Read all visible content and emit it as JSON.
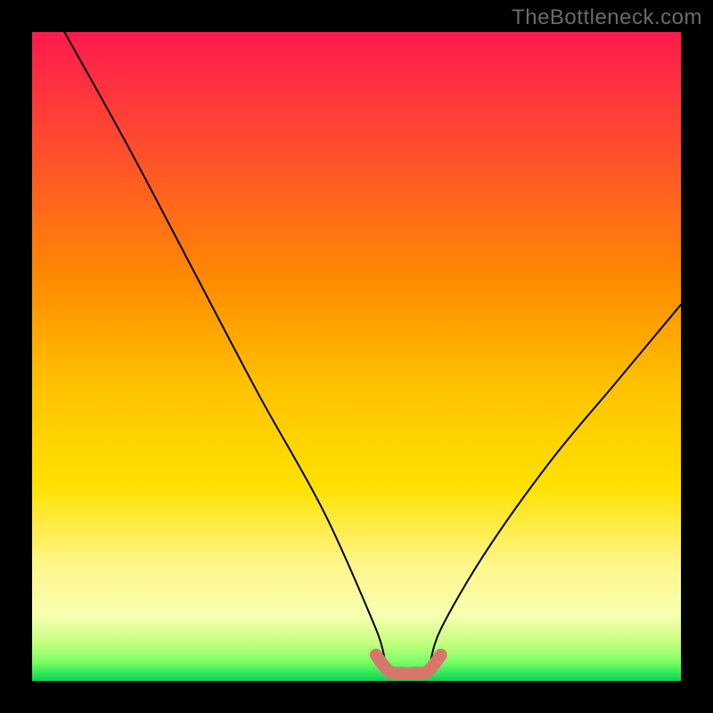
{
  "watermark": "TheBottleneck.com",
  "chart_data": {
    "type": "line",
    "title": "",
    "xlabel": "",
    "ylabel": "",
    "xlim": [
      0,
      100
    ],
    "ylim": [
      0,
      100
    ],
    "series": [
      {
        "name": "bottleneck-curve",
        "x": [
          5,
          15,
          25,
          35,
          45,
          53,
          55,
          59,
          61,
          63,
          70,
          80,
          90,
          100
        ],
        "y": [
          100,
          82,
          63,
          44,
          26,
          8,
          2,
          2,
          2,
          8,
          20,
          34,
          46,
          58
        ]
      }
    ],
    "marker_segment": {
      "name": "optimal-range",
      "x": [
        53,
        55,
        57,
        59,
        61,
        63
      ],
      "y": [
        4,
        1.5,
        1.2,
        1.2,
        1.5,
        4
      ]
    }
  }
}
